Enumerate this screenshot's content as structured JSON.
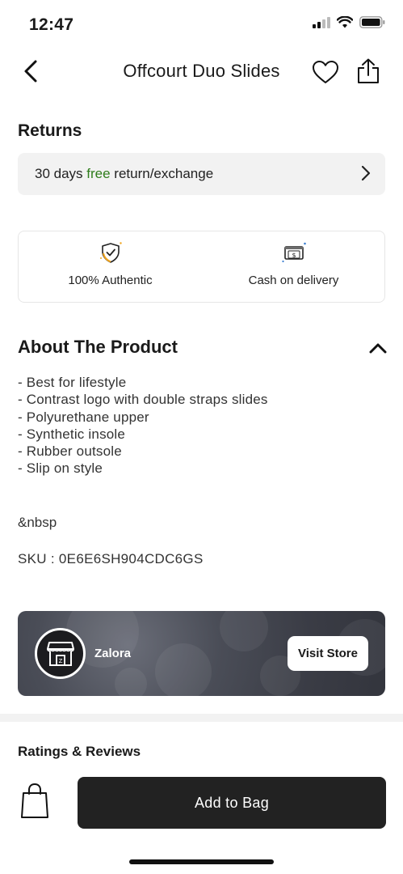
{
  "status_bar": {
    "time": "12:47"
  },
  "nav": {
    "title": "Offcourt Duo Slides"
  },
  "returns": {
    "title": "Returns",
    "prefix": "30 days ",
    "free": "free",
    "suffix": " return/exchange",
    "free_color": "#2f7d1c"
  },
  "badges": [
    {
      "label": "100% Authentic",
      "icon": "shield-check-icon"
    },
    {
      "label": "Cash on delivery",
      "icon": "cash-icon"
    }
  ],
  "about": {
    "title": "About The Product",
    "items": [
      "- Best for lifestyle",
      "- Contrast logo with double straps slides",
      "- Polyurethane upper",
      "- Synthetic insole",
      "- Rubber outsole",
      "- Slip on style"
    ],
    "nbsp": "&nbsp",
    "sku": "SKU : 0E6E6SH904CDC6GS"
  },
  "store": {
    "name": "Zalora",
    "visit_label": "Visit Store"
  },
  "ratings": {
    "title": "Ratings & Reviews"
  },
  "bottom": {
    "add_label": "Add to Bag"
  },
  "colors": {
    "button_dark": "#222222",
    "surface_gray": "#f2f2f2"
  }
}
